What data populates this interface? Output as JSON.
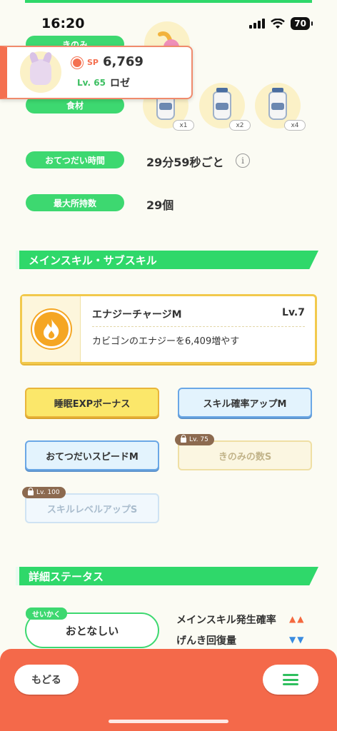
{
  "status_bar": {
    "time": "16:20",
    "battery": "70"
  },
  "ingredient_section": {
    "berry_label": "きのみ",
    "ingredient_label": "食材",
    "ingredients": [
      {
        "icon": "milk-bottle-icon",
        "quantity": "x1"
      },
      {
        "icon": "milk-bottle-icon",
        "quantity": "x2"
      },
      {
        "icon": "milk-bottle-icon",
        "quantity": "x4"
      }
    ]
  },
  "pokemon_card": {
    "sp_label": "SP",
    "sp_value": "6,769",
    "level": "Lv. 65",
    "name": "ロゼ"
  },
  "info_rows": {
    "help_time_label": "おてつだい時間",
    "help_time_value": "29分59秒ごと",
    "max_carry_label": "最大所持数",
    "max_carry_value": "29個",
    "info_icon": "i"
  },
  "skill_section": {
    "header": "メインスキル・サブスキル",
    "main_skill": {
      "name": "エナジーチャージM",
      "level": "Lv.7",
      "description": "カビゴンのエナジーを6,409増やす",
      "icon": "flame-icon"
    },
    "sub_skills": [
      {
        "label": "睡眠EXPボーナス",
        "style": "gold",
        "locked": false
      },
      {
        "label": "スキル確率アップM",
        "style": "blue",
        "locked": false
      },
      {
        "label": "おてつだいスピードM",
        "style": "blue",
        "locked": false
      },
      {
        "label": "きのみの数S",
        "style": "gold",
        "locked": true,
        "unlock_level": "Lv. 75"
      },
      {
        "label": "スキルレベルアップS",
        "style": "blue",
        "locked": true,
        "unlock_level": "Lv. 100"
      }
    ]
  },
  "detail_section": {
    "header": "詳細ステータス",
    "nature_tag": "せいかく",
    "nature_value": "おとなしい",
    "effects": [
      {
        "label": "メインスキル発生確率",
        "arrows": "▲▲"
      },
      {
        "label": "げんき回復量",
        "arrows": "▼▼"
      }
    ]
  },
  "bottom_bar": {
    "back_label": "もどる"
  },
  "colors": {
    "accent_green": "#2fd86a",
    "accent_orange": "#f4694a",
    "gold": "#f2c94c",
    "blue": "#6aa7e6"
  }
}
